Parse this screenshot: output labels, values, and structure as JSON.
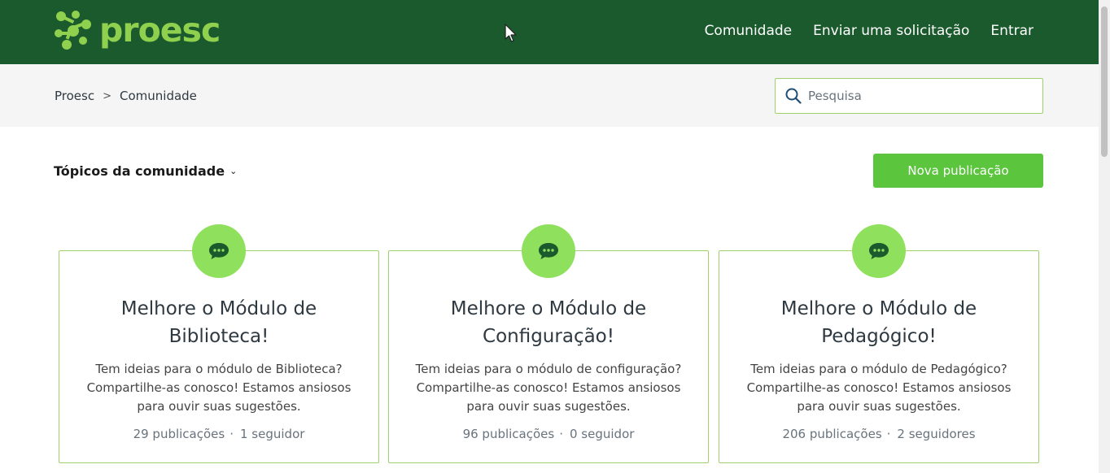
{
  "header": {
    "brand": "proesc",
    "nav": [
      {
        "label": "Comunidade"
      },
      {
        "label": "Enviar uma solicitação"
      },
      {
        "label": "Entrar"
      }
    ]
  },
  "breadcrumb": {
    "root": "Proesc",
    "separator": ">",
    "current": "Comunidade"
  },
  "search": {
    "placeholder": "Pesquisa"
  },
  "toolbar": {
    "topics_label": "Tópicos da comunidade",
    "new_post_label": "Nova publicação"
  },
  "cards": [
    {
      "title": "Melhore o Módulo de Biblioteca!",
      "description": "Tem ideias para o módulo de Biblioteca? Compartilhe-as conosco! Estamos ansiosos para ouvir suas sugestões.",
      "posts": "29 publicações",
      "followers": "1 seguidor"
    },
    {
      "title": "Melhore o Módulo de Configuração!",
      "description": "Tem ideias para o módulo de configuração? Compartilhe-as conosco! Estamos ansiosos para ouvir suas sugestões.",
      "posts": "96 publicações",
      "followers": "0 seguidor"
    },
    {
      "title": "Melhore o Módulo de Pedagógico!",
      "description": "Tem ideias para o módulo de Pedagógico? Compartilhe-as conosco! Estamos ansiosos para ouvir suas sugestões.",
      "posts": "206 publicações",
      "followers": "2 seguidores"
    }
  ],
  "colors": {
    "header_bg": "#1a5a2c",
    "brand_green": "#8fd14f",
    "button_green": "#5bc53e",
    "card_border": "#9fd26e",
    "badge_bg": "#8fe05c"
  },
  "icons": {
    "logo": "molecule-logo-icon",
    "search": "search-icon",
    "topics_chevron": "chevron-down-icon",
    "card_badge": "chat-bubble-icon"
  }
}
